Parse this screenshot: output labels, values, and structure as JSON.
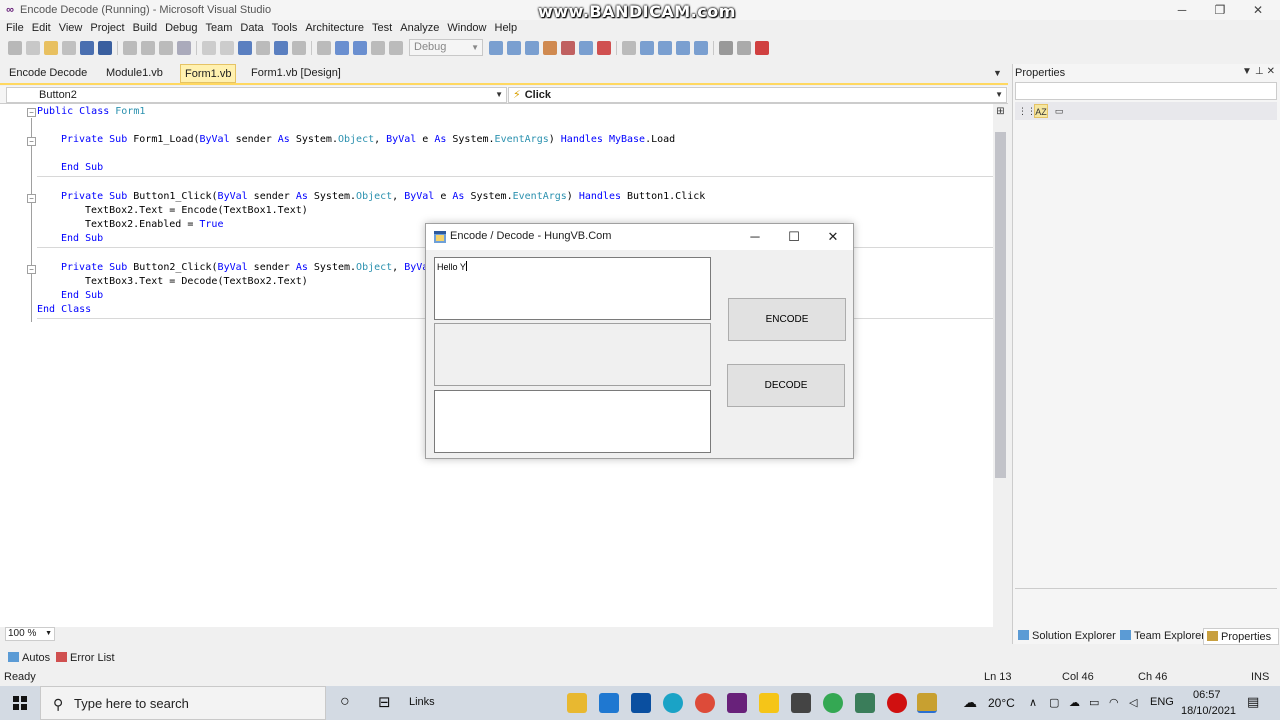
{
  "window": {
    "title": "Encode Decode (Running) - Microsoft Visual Studio",
    "watermark": "www.BANDICAM.com"
  },
  "menu": [
    "File",
    "Edit",
    "View",
    "Project",
    "Build",
    "Debug",
    "Team",
    "Data",
    "Tools",
    "Architecture",
    "Test",
    "Analyze",
    "Window",
    "Help"
  ],
  "toolbar": {
    "config": "Debug"
  },
  "tabs": [
    {
      "label": "Encode Decode",
      "active": false
    },
    {
      "label": "Module1.vb",
      "active": false
    },
    {
      "label": "Form1.vb",
      "active": true
    },
    {
      "label": "Form1.vb [Design]",
      "active": false
    }
  ],
  "nav": {
    "object": "Button2",
    "event": "Click"
  },
  "code": {
    "l1": [
      "Public Class",
      " Form1"
    ],
    "l2": [
      "Private Sub",
      " Form1_Load(",
      "ByVal",
      " sender ",
      "As",
      " System.",
      "Object",
      ", ",
      "ByVal",
      " e ",
      "As",
      " System.",
      "EventArgs",
      ") ",
      "Handles",
      " MyBase",
      ".Load"
    ],
    "l3": [
      "End Sub"
    ],
    "l4": [
      "Private Sub",
      " Button1_Click(",
      "ByVal",
      " sender ",
      "As",
      " System.",
      "Object",
      ", ",
      "ByVal",
      " e ",
      "As",
      " System.",
      "EventArgs",
      ") ",
      "Handles",
      " Button1.Click"
    ],
    "l5": "TextBox2.Text = Encode(TextBox1.Text)",
    "l6": [
      "TextBox2.Enabled = ",
      "True"
    ],
    "l7": [
      "End Sub"
    ],
    "l8": [
      "Private Sub",
      " Button2_Click(",
      "ByVal",
      " sender ",
      "As",
      " System.",
      "Object",
      ", ",
      "ByVal"
    ],
    "l9": "TextBox3.Text = Decode(TextBox2.Text)",
    "l10": [
      "End Sub"
    ],
    "l11": [
      "End Class"
    ]
  },
  "zoom": "100 %",
  "properties": {
    "title": "Properties"
  },
  "right_tabs": [
    "Solution Explorer",
    "Team Explorer",
    "Properties"
  ],
  "bottom_tabs": [
    "Autos",
    "Error List"
  ],
  "status": {
    "left": "Ready",
    "ln": "Ln 13",
    "col": "Col 46",
    "ch": "Ch 46",
    "mode": "INS"
  },
  "app": {
    "title": "Encode / Decode - HungVB.Com",
    "textbox1": "Hello Y",
    "encode_label": "ENCODE",
    "decode_label": "DECODE"
  },
  "taskbar": {
    "search_placeholder": "Type here to search",
    "links": "Links",
    "temp": "20°C",
    "lang": "ENG",
    "time": "06:57",
    "date": "18/10/2021"
  },
  "colors": {
    "keyword": "#0000ff",
    "type": "#2b91af",
    "tab_active": "#fff1b0",
    "accent": "#ffd860"
  }
}
